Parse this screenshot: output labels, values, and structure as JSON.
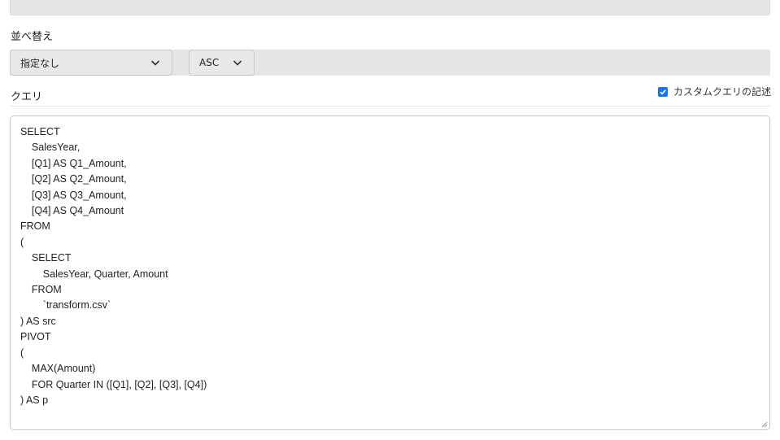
{
  "sort": {
    "label": "並べ替え",
    "field_value": "指定なし",
    "order_value": "ASC"
  },
  "query": {
    "label": "クエリ",
    "custom_label": "カスタムクエリの記述",
    "custom_checked": true,
    "text": "SELECT\n\tSalesYear,\n\t[Q1] AS Q1_Amount,\n\t[Q2] AS Q2_Amount,\n\t[Q3] AS Q3_Amount,\n\t[Q4] AS Q4_Amount\nFROM\n(\n\tSELECT\n\t\tSalesYear, Quarter, Amount\n\tFROM\n\t\t`transform.csv`\n) AS src\nPIVOT\n(\n\tMAX(Amount)\n\tFOR Quarter IN ([Q1], [Q2], [Q3], [Q4])\n) AS p"
  },
  "colors": {
    "accent": "#1a73e8",
    "panel_bg": "#e6e6e6",
    "border": "#c8c8c8"
  },
  "icons": {
    "dropdown": "chevron-down-icon",
    "checkbox": "check-icon",
    "resize": "resize-handle-icon"
  }
}
